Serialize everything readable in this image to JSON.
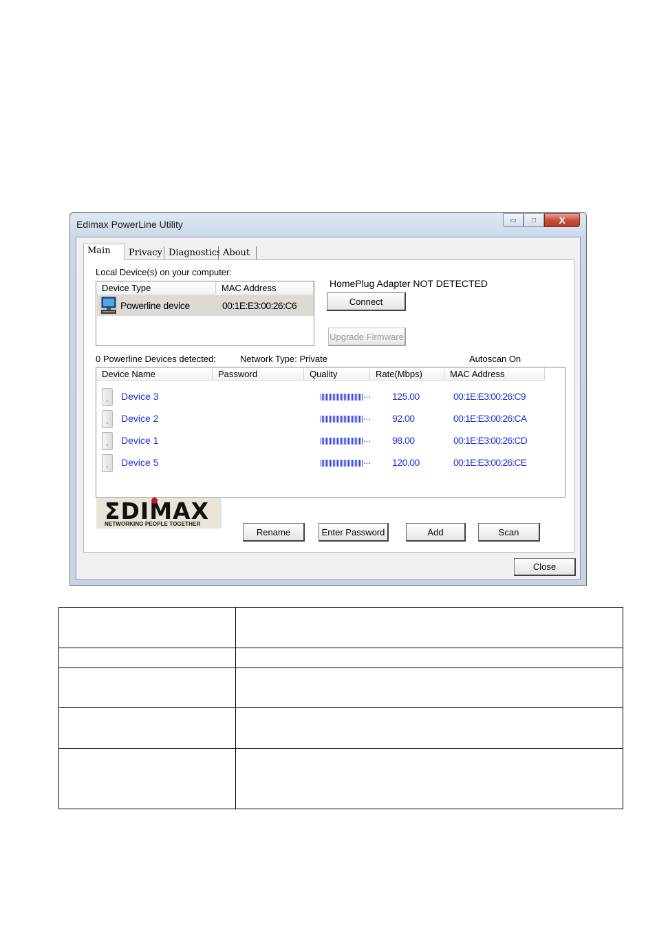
{
  "window": {
    "title": "Edimax PowerLine Utility",
    "min_label": "▭",
    "max_label": "□",
    "close_label": "X"
  },
  "tabs": [
    "Main",
    "Privacy",
    "Diagnostics",
    "About"
  ],
  "local": {
    "heading": "Local Device(s) on your computer:",
    "col_type": "Device Type",
    "col_mac": "MAC Address",
    "device_type": "Powerline device",
    "device_mac": "00:1E:E3:00:26:C6"
  },
  "adapter_status": "HomePlug Adapter NOT DETECTED",
  "buttons": {
    "connect": "Connect",
    "upgrade": "Upgrade Firmware",
    "rename": "Rename",
    "enter_password": "Enter Password",
    "add": "Add",
    "scan": "Scan",
    "close": "Close"
  },
  "status": {
    "detected": "0 Powerline Devices detected:",
    "network_type": "Network Type: Private",
    "autoscan": "Autoscan On"
  },
  "table": {
    "headers": [
      "Device Name",
      "Password",
      "Quality",
      "Rate(Mbps)",
      "MAC Address"
    ],
    "quality_suffix": "...",
    "rows": [
      {
        "name": "Device 3",
        "rate": "125.00",
        "mac": "00:1E:E3:00:26:C9"
      },
      {
        "name": "Device 2",
        "rate": "92.00",
        "mac": "00:1E:E3:00:26:CA"
      },
      {
        "name": "Device 1",
        "rate": "98.00",
        "mac": "00:1E:E3:00:26:CD"
      },
      {
        "name": "Device 5",
        "rate": "120.00",
        "mac": "00:1E:E3:00:26:CE"
      }
    ]
  },
  "logo": {
    "name": "ΣDIMAX",
    "tagline": "NETWORKING PEOPLE TOGETHER"
  },
  "colors": {
    "link_blue": "#1d2fd8",
    "logo_red": "#c8102e"
  }
}
